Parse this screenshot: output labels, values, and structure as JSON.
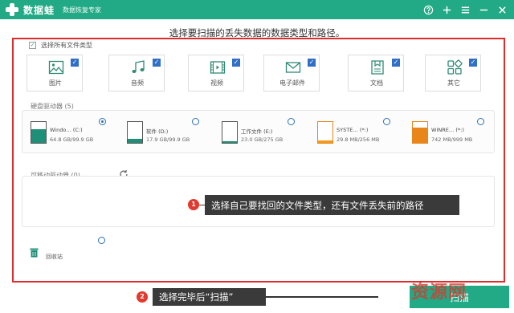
{
  "titlebar": {
    "app_name": "数据蛙",
    "subtitle": "数据恢复专家",
    "icons": [
      "help-icon",
      "plus-icon",
      "menu-icon",
      "minimize-icon",
      "close-icon"
    ],
    "bg_color": "#22a985"
  },
  "heading": "选择要扫描的丢失数据的数据类型和路径。",
  "select_all": {
    "label": "选择所有文件类型",
    "checked": true
  },
  "file_types": [
    {
      "label": "图片",
      "icon": "image-icon",
      "checked": true
    },
    {
      "label": "音频",
      "icon": "audio-icon",
      "checked": true
    },
    {
      "label": "视频",
      "icon": "video-icon",
      "checked": true
    },
    {
      "label": "电子邮件",
      "icon": "email-icon",
      "checked": true
    },
    {
      "label": "文档",
      "icon": "document-icon",
      "checked": true
    },
    {
      "label": "其它",
      "icon": "other-icon",
      "checked": true
    }
  ],
  "disk_section": {
    "title": "硬盘驱动器 (5)",
    "drives": [
      {
        "name": "Windo… (C:)",
        "size": "64.8 GB/99.9 GB",
        "fill": 0.65,
        "fill_color": "#1f8f78",
        "selected": true
      },
      {
        "name": "软件 (D:)",
        "size": "17.9 GB/99.9 GB",
        "fill": 0.18,
        "fill_color": "#1f8f78",
        "selected": false
      },
      {
        "name": "工作文件 (E:)",
        "size": "23.0 GB/275 GB",
        "fill": 0.08,
        "fill_color": "#1f8f78",
        "selected": false
      },
      {
        "name": "SYSTE… (*:)",
        "size": "29.8 MB/256 MB",
        "fill": 0.12,
        "fill_color": "#f29a1f",
        "selected": false
      },
      {
        "name": "WINRE… (*:)",
        "size": "742 MB/999 MB",
        "fill": 0.74,
        "fill_color": "#e8861a",
        "selected": false
      }
    ]
  },
  "removable_section": {
    "title": "可移动驱动器 (0)"
  },
  "recycle_bin": {
    "label": "回收站",
    "selected": false
  },
  "annotations": {
    "step1_num": "1",
    "step1_text": "选择自己要找回的文件类型，还有文件丢失前的路径",
    "step2_num": "2",
    "step2_text": "选择完毕后“扫描”"
  },
  "scan_button": {
    "label": "扫描"
  },
  "watermark": {
    "text": "资源网",
    "brand_color": "#d63b2f"
  }
}
